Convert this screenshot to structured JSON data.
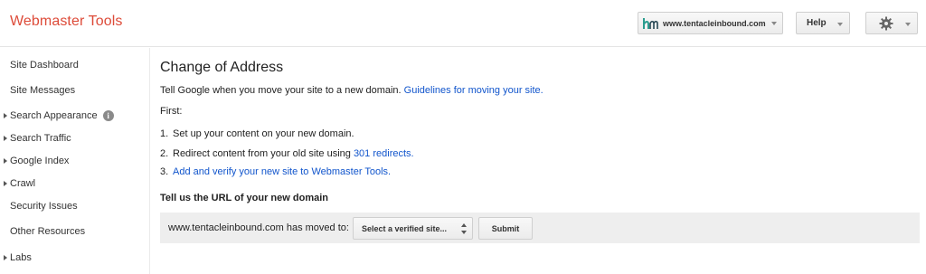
{
  "app": {
    "title": "Webmaster Tools"
  },
  "header": {
    "site_selector": {
      "value": "www.tentacleinbound.com"
    },
    "help_label": "Help",
    "settings_icon": "gear-icon"
  },
  "sidebar": {
    "items": [
      {
        "label": "Site Dashboard",
        "expandable": false
      },
      {
        "label": "Site Messages",
        "expandable": false
      },
      {
        "label": "Search Appearance",
        "expandable": true,
        "info_icon": true
      },
      {
        "label": "Search Traffic",
        "expandable": true
      },
      {
        "label": "Google Index",
        "expandable": true
      },
      {
        "label": "Crawl",
        "expandable": true
      },
      {
        "label": "Security Issues",
        "expandable": false
      },
      {
        "label": "Other Resources",
        "expandable": false
      },
      {
        "label": "Labs",
        "expandable": true
      }
    ]
  },
  "main": {
    "title": "Change of Address",
    "intro_text": "Tell Google when you move your site to a new domain.",
    "intro_link": "Guidelines for moving your site.",
    "first_label": "First:",
    "steps": [
      {
        "num": "1.",
        "text": "Set up your content on your new domain.",
        "link": ""
      },
      {
        "num": "2.",
        "text": "Redirect content from your old site using",
        "link": "301 redirects."
      },
      {
        "num": "3.",
        "text": "",
        "link": "Add and verify your new site to Webmaster Tools."
      }
    ],
    "form_heading": "Tell us the URL of your new domain",
    "form": {
      "moved_text": "www.tentacleinbound.com has moved to:",
      "select_value": "Select a verified site...",
      "submit_label": "Submit"
    }
  },
  "colors": {
    "brand": "#dd4b39",
    "link": "#1155cc",
    "form_bg": "#eeeeee"
  }
}
